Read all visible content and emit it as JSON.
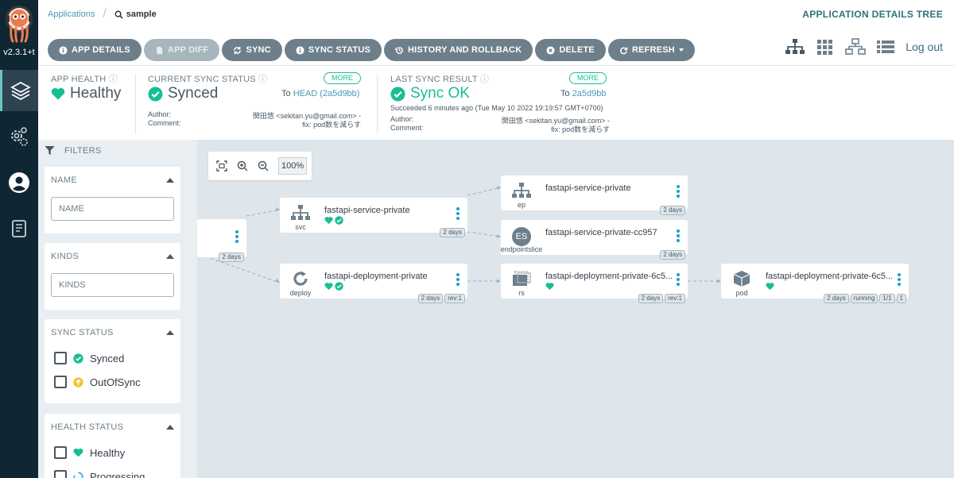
{
  "app": {
    "version": "v2.3.1+t"
  },
  "breadcrumb": {
    "applications": "Applications",
    "current": "sample"
  },
  "view_title": "APPLICATION DETAILS TREE",
  "toolbar": {
    "app_details": "APP DETAILS",
    "app_diff": "APP DIFF",
    "sync": "SYNC",
    "sync_status": "SYNC STATUS",
    "history": "HISTORY AND ROLLBACK",
    "delete": "DELETE",
    "refresh": "REFRESH"
  },
  "logout": "Log out",
  "summary": {
    "app_health": {
      "label": "APP HEALTH",
      "value": "Healthy"
    },
    "current_sync": {
      "label": "CURRENT SYNC STATUS",
      "value": "Synced",
      "more": "MORE",
      "to_prefix": "To",
      "to_ref": "HEAD (2a5d9bb)",
      "author_label": "Author:",
      "author": "関田悠 <sekitan.yu@gmail.com> -",
      "comment_label": "Comment:",
      "comment": "fix: pod数を減らす"
    },
    "last_sync": {
      "label": "LAST SYNC RESULT",
      "value": "Sync OK",
      "more": "MORE",
      "to_prefix": "To",
      "to_ref": "2a5d9bb",
      "succeeded": "Succeeded 6 minutes ago (Tue May 10 2022 19:19:57 GMT+0700)",
      "author_label": "Author:",
      "author": "関田悠 <sekitan.yu@gmail.com> -",
      "comment_label": "Comment:",
      "comment": "fix: pod数を減らす"
    }
  },
  "filters": {
    "header": "FILTERS",
    "name": {
      "label": "NAME",
      "placeholder": "NAME"
    },
    "kinds": {
      "label": "KINDS",
      "placeholder": "KINDS"
    },
    "sync_status": {
      "label": "SYNC STATUS",
      "options": [
        "Synced",
        "OutOfSync"
      ]
    },
    "health_status": {
      "label": "HEALTH STATUS",
      "options": [
        "Healthy",
        "Progressing"
      ]
    }
  },
  "zoom": {
    "level": "100%"
  },
  "nodes": {
    "root": {
      "age": "2 days"
    },
    "svc": {
      "kind": "svc",
      "name": "fastapi-service-private",
      "age": "2 days"
    },
    "deploy": {
      "kind": "deploy",
      "name": "fastapi-deployment-private",
      "age": "2 days",
      "rev": "rev:1"
    },
    "ep": {
      "kind": "ep",
      "name": "fastapi-service-private",
      "age": "2 days"
    },
    "endpointslice": {
      "kind": "endpointslice",
      "icon_text": "ES",
      "name": "fastapi-service-private-cc957",
      "age": "2 days"
    },
    "rs": {
      "kind": "rs",
      "name": "fastapi-deployment-private-6c5...",
      "age": "2 days",
      "rev": "rev:1"
    },
    "pod": {
      "kind": "pod",
      "name": "fastapi-deployment-private-6c5...",
      "age": "2 days",
      "status": "running",
      "ready": "1/1",
      "restarts": "1"
    }
  },
  "colors": {
    "healthy": "#18be94",
    "out_of_sync": "#f4c030",
    "link": "#4999b5",
    "rail": "#0f2733"
  }
}
